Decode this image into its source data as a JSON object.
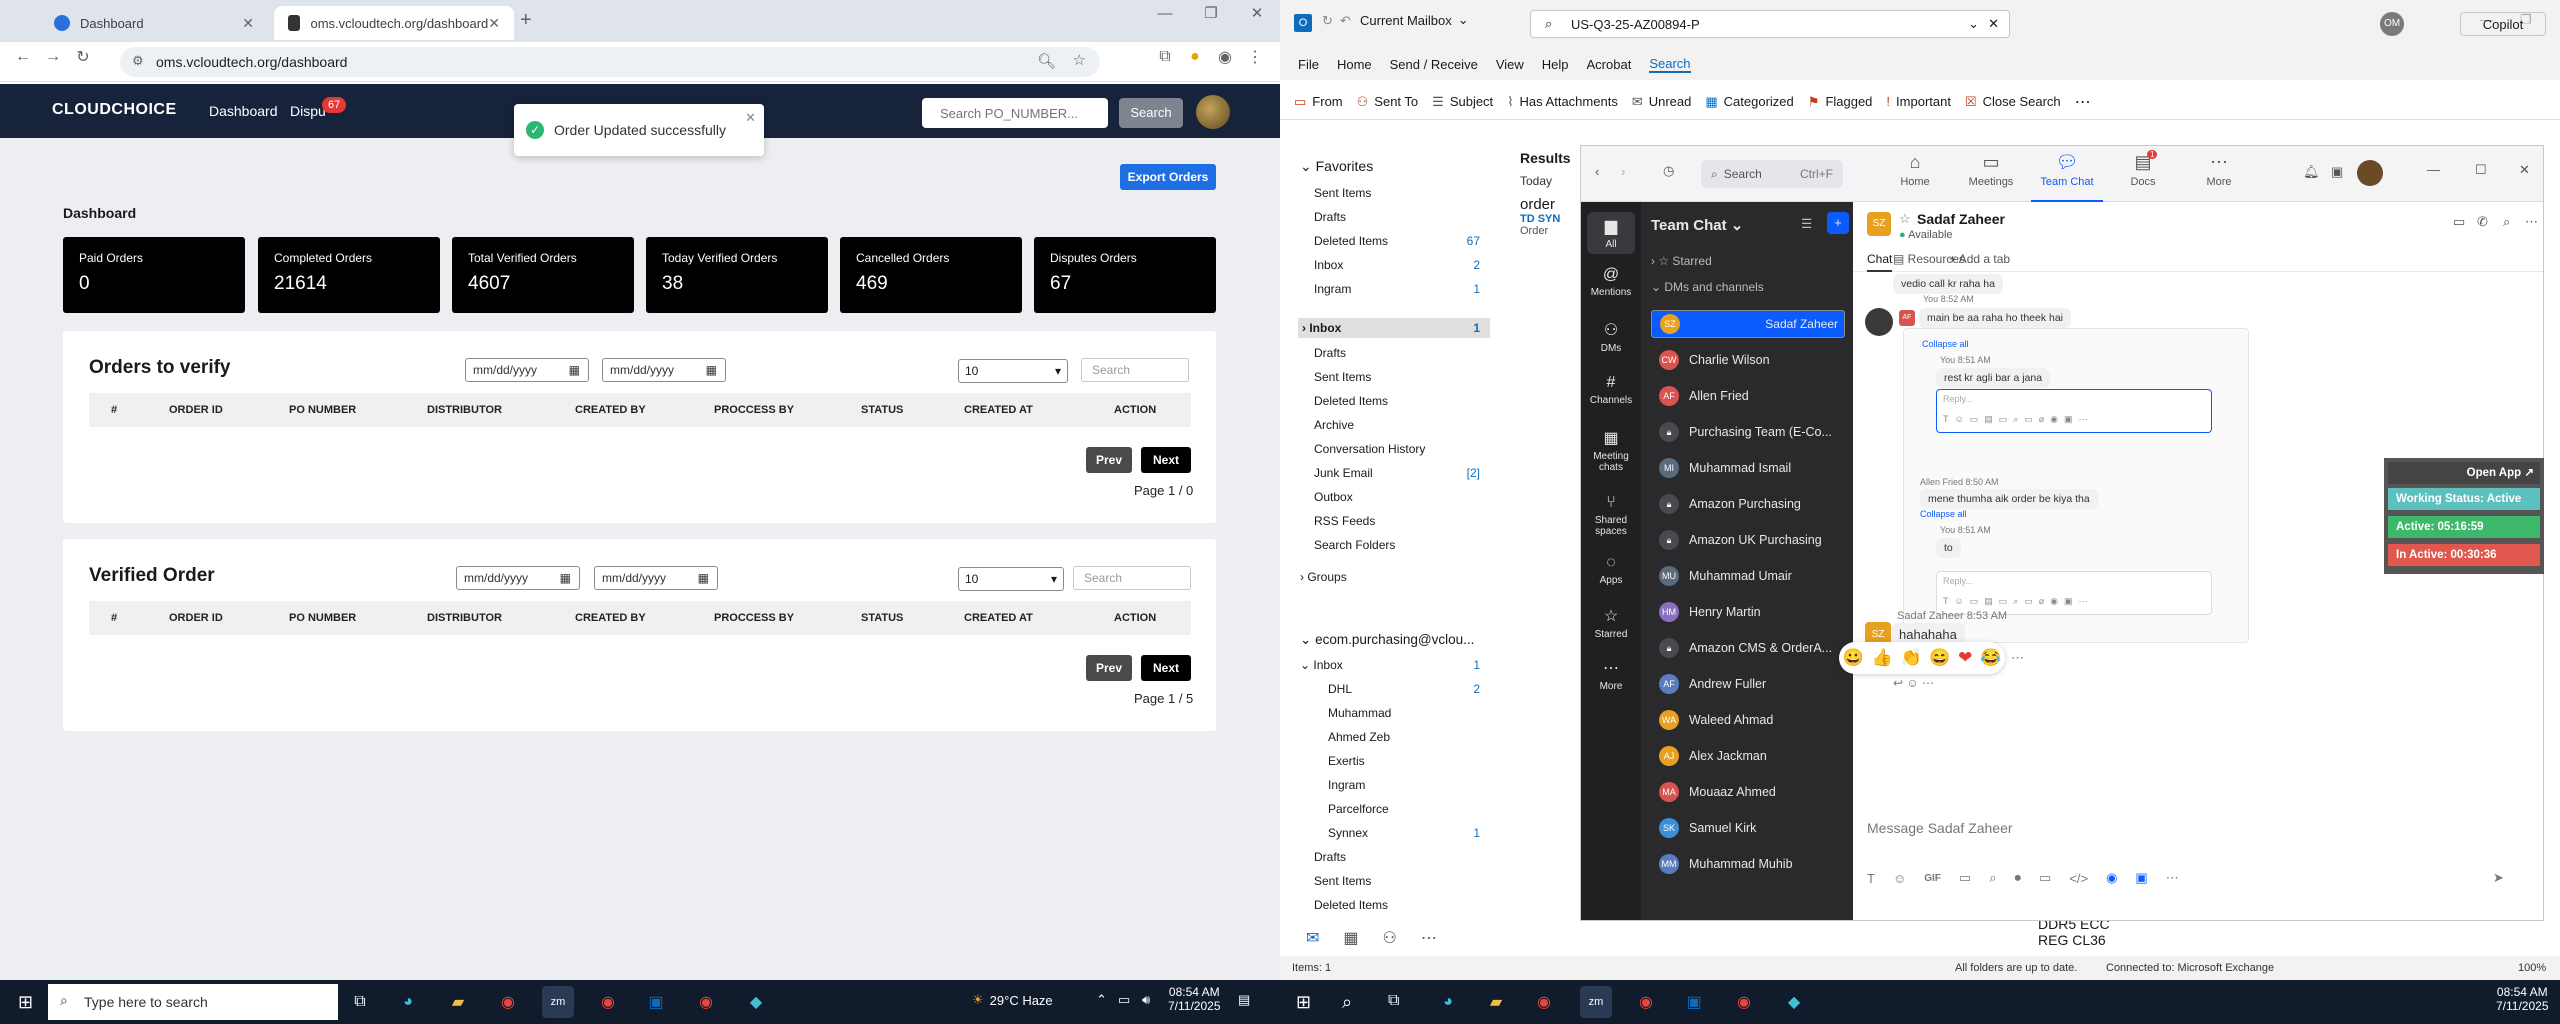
{
  "chrome": {
    "tabs": [
      {
        "title": "Dashboard"
      },
      {
        "title": "oms.vcloudtech.org/dashboard"
      }
    ],
    "url": "oms.vcloudtech.org/dashboard"
  },
  "app": {
    "logo": "CLOUDCHOICE",
    "nav": [
      "Dashboard",
      "Dispu"
    ],
    "disputes_badge": "67",
    "po_placeholder": "Search PO_NUMBER...",
    "search_label": "Search",
    "toast": "Order Updated successfully",
    "export_label": "Export Orders",
    "dashboard_title": "Dashboard",
    "cards": [
      {
        "label": "Paid Orders",
        "value": "0"
      },
      {
        "label": "Completed Orders",
        "value": "21614"
      },
      {
        "label": "Total Verified Orders",
        "value": "4607"
      },
      {
        "label": "Today Verified Orders",
        "value": "38"
      },
      {
        "label": "Cancelled Orders",
        "value": "469"
      },
      {
        "label": "Disputes Orders",
        "value": "67"
      }
    ],
    "date_placeholder": "mm/dd/yyyy",
    "page_size": "10",
    "table_search_placeholder": "Search",
    "columns": [
      "#",
      "ORDER ID",
      "PO NUMBER",
      "DISTRIBUTOR",
      "CREATED BY",
      "PROCCESS BY",
      "STATUS",
      "CREATED AT",
      "ACTION"
    ],
    "prev": "Prev",
    "next": "Next",
    "orders_to_verify": {
      "title": "Orders to verify",
      "pager": "Page 1 / 0"
    },
    "verified_order": {
      "title": "Verified Order",
      "pager": "Page 1 / 5"
    }
  },
  "outlook": {
    "mailbox": "Current Mailbox",
    "search_value": "US-Q3-25-AZ00894-P",
    "account_initials": "OM",
    "copilot": "Copilot",
    "menu": [
      "File",
      "Home",
      "Send / Receive",
      "View",
      "Help",
      "Acrobat",
      "Search"
    ],
    "ribbon": [
      "From",
      "Sent To",
      "Subject",
      "Has Attachments",
      "Unread",
      "Categorized",
      "Flagged",
      "Important",
      "Close Search"
    ],
    "favorites_title": "Favorites",
    "favorites": [
      {
        "name": "Sent Items",
        "count": ""
      },
      {
        "name": "Drafts",
        "count": ""
      },
      {
        "name": "Deleted Items",
        "count": "67"
      },
      {
        "name": "Inbox",
        "count": "2"
      },
      {
        "name": "Ingram",
        "count": "1"
      }
    ],
    "folders": [
      {
        "name": "Inbox",
        "count": "1"
      },
      {
        "name": "Drafts",
        "count": ""
      },
      {
        "name": "Sent Items",
        "count": ""
      },
      {
        "name": "Deleted Items",
        "count": ""
      },
      {
        "name": "Archive",
        "count": ""
      },
      {
        "name": "Conversation History",
        "count": ""
      },
      {
        "name": "Junk Email",
        "count": "[2]"
      },
      {
        "name": "Outbox",
        "count": ""
      },
      {
        "name": "RSS Feeds",
        "count": ""
      },
      {
        "name": "Search Folders",
        "count": ""
      }
    ],
    "groups": "Groups",
    "account": "ecom.purchasing@vclou...",
    "account_folders": [
      {
        "name": "Inbox",
        "count": "1",
        "indent": 0
      },
      {
        "name": "DHL",
        "count": "2",
        "indent": 1
      },
      {
        "name": "Muhammad",
        "count": "",
        "indent": 1
      },
      {
        "name": "Ahmed Zeb",
        "count": "",
        "indent": 1
      },
      {
        "name": "Exertis",
        "count": "",
        "indent": 1
      },
      {
        "name": "Ingram",
        "count": "",
        "indent": 1
      },
      {
        "name": "Parcelforce",
        "count": "",
        "indent": 1
      },
      {
        "name": "Synnex",
        "count": "1",
        "indent": 1
      },
      {
        "name": "Drafts",
        "count": "",
        "indent": 0
      },
      {
        "name": "Sent Items",
        "count": "",
        "indent": 0
      },
      {
        "name": "Deleted Items",
        "count": "",
        "indent": 0
      }
    ],
    "results_label": "Results",
    "today_label": "Today",
    "result_sender": "order",
    "result_sub": "TD SYN",
    "result_preview": "Order",
    "body_lines": [
      "DDR5 ECC",
      "REG CL36"
    ],
    "status_items": "Items: 1",
    "status_sync": "All folders are up to date.",
    "status_conn": "Connected to: Microsoft Exchange",
    "zoom_level": "100%"
  },
  "zoom": {
    "search_label": "Search",
    "search_shortcut": "Ctrl+F",
    "tabs": [
      "Home",
      "Meetings",
      "Team Chat",
      "Docs",
      "More"
    ],
    "docs_badge": "1",
    "rail": [
      "All",
      "Mentions",
      "DMs",
      "Channels",
      "Meeting chats",
      "Shared spaces",
      "Apps",
      "Starred",
      "More"
    ],
    "list_title": "Team Chat",
    "starred": "Starred",
    "dms_header": "DMs and channels",
    "contacts": [
      {
        "name": "Sadaf Zaheer",
        "initials": "SZ",
        "color": "#e8a020"
      },
      {
        "name": "Charlie Wilson",
        "initials": "CW",
        "color": "#d9534f"
      },
      {
        "name": "Allen Fried",
        "initials": "AF",
        "color": "#d9534f"
      },
      {
        "name": "Purchasing Team (E-Co...",
        "initials": "",
        "color": "#555"
      },
      {
        "name": "Muhammad Ismail",
        "initials": "MI",
        "color": "#5a6b7d"
      },
      {
        "name": "Amazon Purchasing",
        "initials": "",
        "color": "#555"
      },
      {
        "name": "Amazon UK Purchasing",
        "initials": "",
        "color": "#555"
      },
      {
        "name": "Muhammad Umair",
        "initials": "MU",
        "color": "#5a6b7d"
      },
      {
        "name": "Henry Martin",
        "initials": "HM",
        "color": "#8a6fbf"
      },
      {
        "name": "Amazon CMS & OrderA...",
        "initials": "",
        "color": "#555"
      },
      {
        "name": "Andrew Fuller",
        "initials": "AF",
        "color": "#5a7dbf"
      },
      {
        "name": "Waleed Ahmad",
        "initials": "WA",
        "color": "#e8a020"
      },
      {
        "name": "Alex Jackman",
        "initials": "AJ",
        "color": "#e8a020"
      },
      {
        "name": "Mouaaz Ahmed",
        "initials": "MA",
        "color": "#d9534f"
      },
      {
        "name": "Samuel Kirk",
        "initials": "SK",
        "color": "#3a8fd9"
      },
      {
        "name": "Muhammad Muhib",
        "initials": "MM",
        "color": "#5a7dbf"
      }
    ],
    "chat_name": "Sadaf Zaheer",
    "chat_initials": "SZ",
    "chat_status": "Available",
    "chat_tab": "Chat",
    "resources_tab": "Resources",
    "add_tab": "Add a tab",
    "msg_partial": "vedio call kr raha ha",
    "you_time": "You 8:52 AM",
    "msg1": "main be aa raha ho theek hai",
    "collapse": "Collapse all",
    "you_time2": "You 8:51 AM",
    "msg2": "rest kr agli bar a jana",
    "reply_placeholder": "Reply...",
    "allen_time": "Allen Fried 8:50 AM",
    "msg3": "mene thumha aik order be kiya tha",
    "you_time3": "You 8:51 AM",
    "msg4": "to",
    "sadaf_time": "Sadaf Zaheer 8:53 AM",
    "msg5": "hahahaha",
    "composer_placeholder": "Message Sadaf Zaheer",
    "gif": "GIF"
  },
  "status_widget": {
    "open": "Open App",
    "working": "Working Status: Active",
    "active": "Active: 05:16:59",
    "inactive": "In Active: 00:30:36"
  },
  "taskbar": {
    "search_placeholder": "Type here to search",
    "weather": "29°C  Haze",
    "time": "08:54 AM",
    "date": "7/11/2025",
    "time2": "08:54 AM",
    "date2": "7/11/2025"
  }
}
